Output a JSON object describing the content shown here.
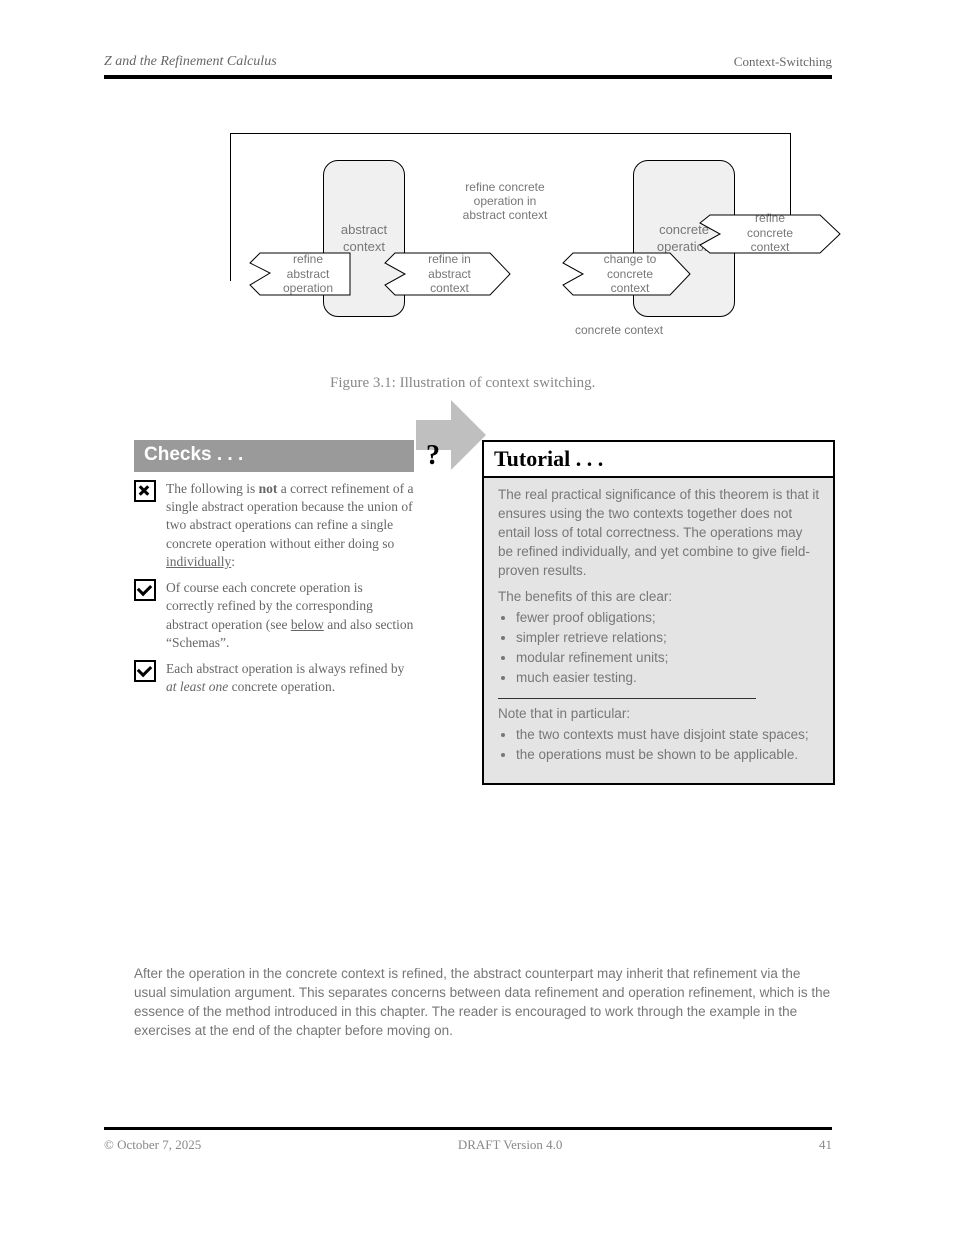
{
  "header": {
    "left_italic": "Z and the Refinement Calculus",
    "right_small": "Context-Switching"
  },
  "diagram": {
    "box1": "abstract\ncontext",
    "box2": "concrete\noperation",
    "arrow1": "refine\nabstract\noperation",
    "arrow2": "refine in\nabstract\ncontext",
    "arrow3": "change to\nconcrete\ncontext",
    "arrow4": "refine\nconcrete\ncontext",
    "concrete_label": "concrete context",
    "abstract_note": "refine concrete\noperation in\nabstract context"
  },
  "fig_caption": "Figure 3.1: Illustration of context switching.",
  "checks": {
    "title": "Checks . . .",
    "item1_pre": "The following is ",
    "item1_not": "not",
    "item1_post": " a correct refinement",
    "item1_rest": "of a single abstract operation because the union of two abstract operations can refine a single concrete operation without either doing so ",
    "item1_link": "individually",
    "item1_tail": ":",
    "item2_pre": "Of course each concrete operation is correctly refined by the corresponding abstract operation (see ",
    "item2_link": "below",
    "item2_mid": " and also section “",
    "item2_ref": "Schemas",
    "item2_end": "”.",
    "item3_pre": "Each abstract operation is always refined by ",
    "item3_em": "at least one",
    "item3_rest": " concrete operation."
  },
  "tutorial": {
    "title": "Tutorial . . .",
    "p1": "The real practical significance of this theorem is that it ensures using the two contexts together does not entail loss of total correctness. The operations may be refined individually, and yet combine to give field-proven results.",
    "p2": "The benefits of this are clear:",
    "b1": "fewer proof obligations;",
    "b2": "simpler retrieve relations;",
    "b3": "modular refinement units;",
    "b4": "much easier testing.",
    "note_head": "Note that in particular:",
    "n1": "the two contexts must have disjoint state spaces;",
    "n2": "the operations must be shown to be applicable."
  },
  "body_below": "After the operation in the concrete context is refined, the abstract counterpart may inherit that refinement via the usual simulation argument. This separates concerns between data refinement and operation refinement, which is the essence of the method introduced in this chapter. The reader is encouraged to work through the example in the exercises at the end of the chapter before moving on.",
  "footer": {
    "left": "© October 7, 2025",
    "center": "DRAFT Version 4.0",
    "right": "41"
  }
}
